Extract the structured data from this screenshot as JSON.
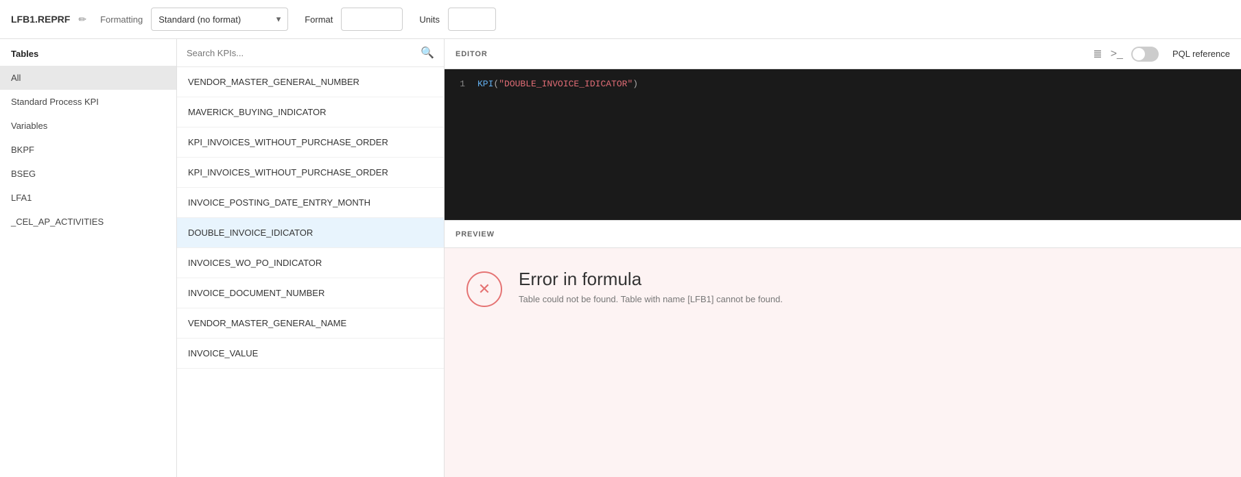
{
  "header": {
    "title": "LFB1.REPRF",
    "edit_icon": "✏",
    "formatting_label": "Formatting",
    "format_select_value": "Standard (no format)",
    "format_label": "Format",
    "units_label": "Units",
    "format_input_value": "",
    "units_input_value": ""
  },
  "sidebar": {
    "section_title": "Tables",
    "items": [
      {
        "label": "All",
        "active": true
      },
      {
        "label": "Standard Process KPI",
        "active": false
      },
      {
        "label": "Variables",
        "active": false
      },
      {
        "label": "BKPF",
        "active": false
      },
      {
        "label": "BSEG",
        "active": false
      },
      {
        "label": "LFA1",
        "active": false
      },
      {
        "label": "_CEL_AP_ACTIVITIES",
        "active": false
      }
    ]
  },
  "kpi_panel": {
    "search_placeholder": "Search KPIs...",
    "items": [
      {
        "label": "VENDOR_MASTER_GENERAL_NUMBER",
        "selected": false
      },
      {
        "label": "MAVERICK_BUYING_INDICATOR",
        "selected": false
      },
      {
        "label": "KPI_INVOICES_WITHOUT_PURCHASE_ORDER",
        "selected": false
      },
      {
        "label": "KPI_INVOICES_WITHOUT_PURCHASE_ORDER",
        "selected": false
      },
      {
        "label": "INVOICE_POSTING_DATE_ENTRY_MONTH",
        "selected": false
      },
      {
        "label": "DOUBLE_INVOICE_IDICATOR",
        "selected": true
      },
      {
        "label": "INVOICES_WO_PO_INDICATOR",
        "selected": false
      },
      {
        "label": "INVOICE_DOCUMENT_NUMBER",
        "selected": false
      },
      {
        "label": "VENDOR_MASTER_GENERAL_NAME",
        "selected": false
      },
      {
        "label": "INVOICE_VALUE",
        "selected": false
      }
    ]
  },
  "editor": {
    "section_label": "EDITOR",
    "pql_reference_label": "PQL reference",
    "line_number": "1",
    "code_keyword": "KPI",
    "code_open_paren": "(",
    "code_string": "\"DOUBLE_INVOICE_IDICATOR\"",
    "code_close_paren": ")"
  },
  "preview": {
    "section_label": "PREVIEW",
    "error_title": "Error in formula",
    "error_description": "Table could not be found. Table with name [LFB1] cannot be found."
  }
}
